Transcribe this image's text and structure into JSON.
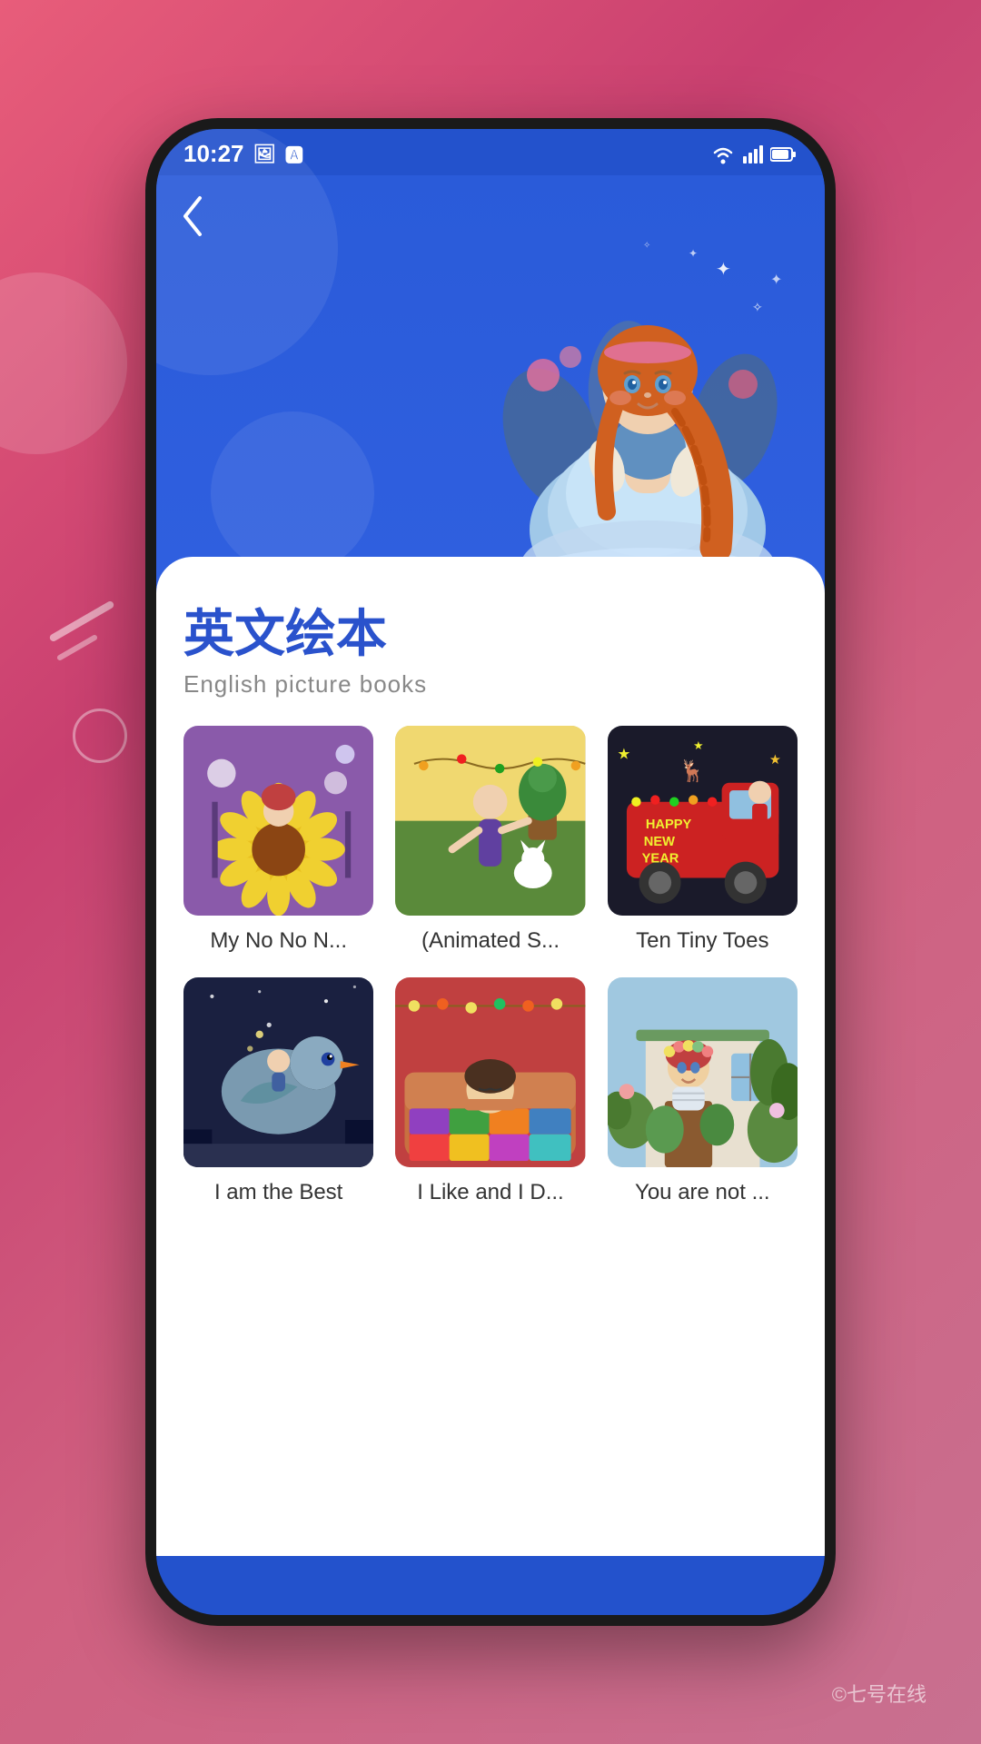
{
  "status_bar": {
    "time": "10:27",
    "icons": [
      "image",
      "font",
      "wifi",
      "signal",
      "battery"
    ]
  },
  "header": {
    "back_label": "‹",
    "title_cn": "英文绘本",
    "title_en": "English picture books"
  },
  "books": [
    {
      "id": "book1",
      "title": "My No No N...",
      "cover_color1": "#7b4fa0",
      "cover_color2": "#c8e87a",
      "cover_type": "sunflower"
    },
    {
      "id": "book2",
      "title": "(Animated S...",
      "cover_color1": "#d4b86a",
      "cover_color2": "#5a8a3a",
      "cover_type": "garden"
    },
    {
      "id": "book3",
      "title": "Ten Tiny Toes",
      "cover_color1": "#cc2222",
      "cover_color2": "#f0c040",
      "cover_type": "christmas"
    },
    {
      "id": "book4",
      "title": "I am the Best",
      "cover_color1": "#1a2040",
      "cover_color2": "#6090c0",
      "cover_type": "bird"
    },
    {
      "id": "book5",
      "title": "I Like and I D...",
      "cover_color1": "#c04040",
      "cover_color2": "#d08040",
      "cover_type": "sleeping"
    },
    {
      "id": "book6",
      "title": "You are not ...",
      "cover_color1": "#7ab870",
      "cover_color2": "#a0c8e0",
      "cover_type": "girl-garden"
    }
  ],
  "watermark": "©七号在线"
}
